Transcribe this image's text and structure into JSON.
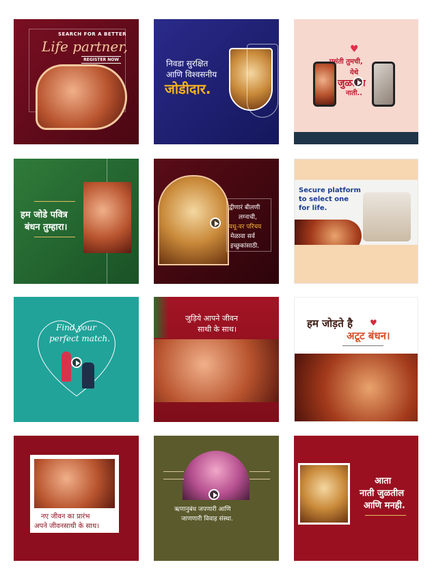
{
  "tiles": [
    {
      "top_text": "SEARCH FOR A BETTER",
      "script_text": "Life partner,",
      "button": "REGISTER NOW"
    },
    {
      "line1": "निवडा सुरक्षित",
      "line2": "आणि विश्वसनीय",
      "big": "जोडीदार."
    },
    {
      "line1": "पसंती तुमची,",
      "line2": "येथे",
      "line3": "जुळतात",
      "line4": "नाती.."
    },
    {
      "line1": "हम जोडे पवित्र",
      "line2": "बंधन तुम्हारा।"
    },
    {
      "line1": "द्वीणारं बीलणी",
      "line2": "लग्नाची,",
      "line3": "वधू-वर परिचय",
      "line4": "मेळावा सर्व",
      "line5": "इच्छुकांसाठी."
    },
    {
      "line1": "Secure platform",
      "line2": "to select one",
      "line3": "for life."
    },
    {
      "line1": "Find your",
      "line2": "perfect match."
    },
    {
      "line1": "जुड़िये आपने जीवन",
      "line2": "साथी के साथ।"
    },
    {
      "line1": "हम जोड़ते है",
      "line2": "अटूट बंधन।"
    },
    {
      "line1": "नए जीवन का प्रारंभ",
      "line2": "अपने जीवनसाथी के साथ।"
    },
    {
      "line1": "ऋणानुबंध जपणारी आणि",
      "line2": "जाणणारी विवाह संस्था."
    },
    {
      "line1": "आता",
      "line2": "नाती जुळतील",
      "line3": "आणि मनही."
    }
  ]
}
